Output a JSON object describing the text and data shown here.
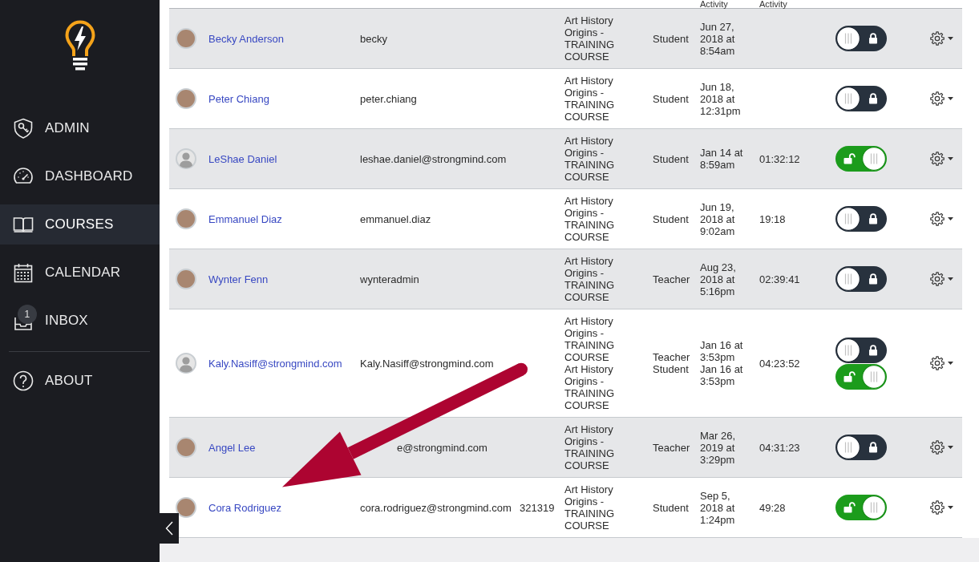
{
  "sidebar": {
    "items": [
      {
        "label": "ADMIN",
        "selected": false
      },
      {
        "label": "DASHBOARD",
        "selected": false
      },
      {
        "label": "COURSES",
        "selected": true
      },
      {
        "label": "CALENDAR",
        "selected": false
      },
      {
        "label": "INBOX",
        "selected": false,
        "badge": "1"
      }
    ],
    "bottom_items": [
      {
        "label": "ABOUT",
        "selected": false
      }
    ]
  },
  "table": {
    "header": {
      "column_7": "Activity",
      "column_8": "Activity"
    },
    "rows": [
      {
        "avatar": {
          "kind": "photo"
        },
        "name": "Becky Anderson",
        "username": "becky",
        "enrollments": [
          {
            "course": "Art History Origins - TRAINING COURSE",
            "role": "Student",
            "last_activity": "Jun 27, 2018 at 8:54am",
            "unlocked": false
          }
        ]
      },
      {
        "avatar": {
          "kind": "photo"
        },
        "name": "Peter Chiang",
        "username": "peter.chiang",
        "enrollments": [
          {
            "course": "Art History Origins - TRAINING COURSE",
            "role": "Student",
            "last_activity": "Jun 18, 2018 at 12:31pm",
            "unlocked": false
          }
        ]
      },
      {
        "avatar": {
          "kind": "default"
        },
        "name": "LeShae Daniel",
        "username": "leshae.daniel@strongmind.com",
        "total_activity": "01:32:12",
        "enrollments": [
          {
            "course": "Art History Origins - TRAINING COURSE",
            "role": "Student",
            "last_activity": "Jan 14 at 8:59am",
            "unlocked": true
          }
        ]
      },
      {
        "avatar": {
          "kind": "photo"
        },
        "name": "Emmanuel Diaz",
        "username": "emmanuel.diaz",
        "total_activity": "19:18",
        "enrollments": [
          {
            "course": "Art History Origins - TRAINING COURSE",
            "role": "Student",
            "last_activity": "Jun 19, 2018 at 9:02am",
            "unlocked": false
          }
        ]
      },
      {
        "avatar": {
          "kind": "photo"
        },
        "name": "Wynter Fenn",
        "username": "wynteradmin",
        "total_activity": "02:39:41",
        "enrollments": [
          {
            "course": "Art History Origins - TRAINING COURSE",
            "role": "Teacher",
            "last_activity": "Aug 23, 2018 at 5:16pm",
            "unlocked": false
          }
        ]
      },
      {
        "avatar": {
          "kind": "default"
        },
        "name": "Kaly.Nasiff@strongmind.com",
        "username": "Kaly.Nasiff@strongmind.com",
        "total_activity": "04:23:52",
        "enrollments": [
          {
            "course": "Art History Origins - TRAINING COURSE",
            "role": "Teacher",
            "last_activity": "Jan 16 at 3:53pm",
            "unlocked": false
          },
          {
            "course": "Art History Origins - TRAINING COURSE",
            "role": "Student",
            "last_activity": "Jan 16 at 3:53pm",
            "unlocked": true
          }
        ]
      },
      {
        "avatar": {
          "kind": "photo"
        },
        "name": "Angel Lee",
        "username_visible_end": "e@strongmind.com",
        "total_activity": "04:31:23",
        "enrollments": [
          {
            "course": "Art History Origins - TRAINING COURSE",
            "role": "Teacher",
            "last_activity": "Mar 26, 2019 at 3:29pm",
            "unlocked": false
          }
        ]
      },
      {
        "avatar": {
          "kind": "photo"
        },
        "name": "Cora Rodriguez",
        "username": "cora.rodriguez@strongmind.com",
        "user_id": "321319",
        "total_activity": "49:28",
        "enrollments": [
          {
            "course": "Art History Origins - TRAINING COURSE",
            "role": "Student",
            "last_activity": "Sep 5, 2018 at 1:24pm",
            "unlocked": true
          }
        ]
      }
    ]
  },
  "annotation": {
    "kind": "arrow"
  }
}
